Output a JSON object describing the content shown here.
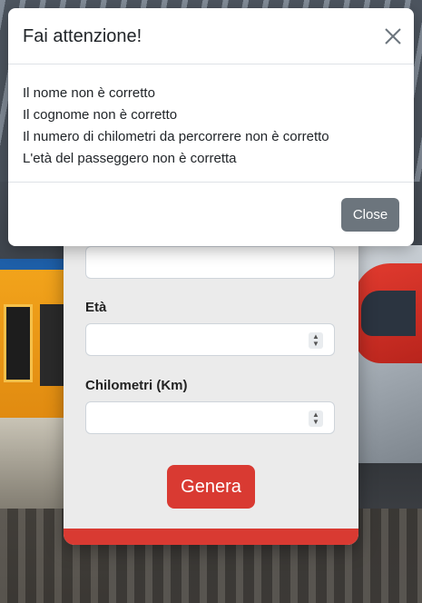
{
  "modal": {
    "title": "Fai attenzione!",
    "messages": [
      "Il nome non è corretto",
      "Il cognome non è corretto",
      "Il numero di chilometri da percorrere non è corretto",
      "L'età del passeggero non è corretta"
    ],
    "close_label": "Close",
    "close_icon": "close-icon"
  },
  "form": {
    "age_label": "Età",
    "km_label": "Chilometri (Km)",
    "submit_label": "Genera"
  },
  "colors": {
    "accent": "#d93a32",
    "secondary_button": "#6c757d",
    "card_background": "#ebebeb"
  }
}
